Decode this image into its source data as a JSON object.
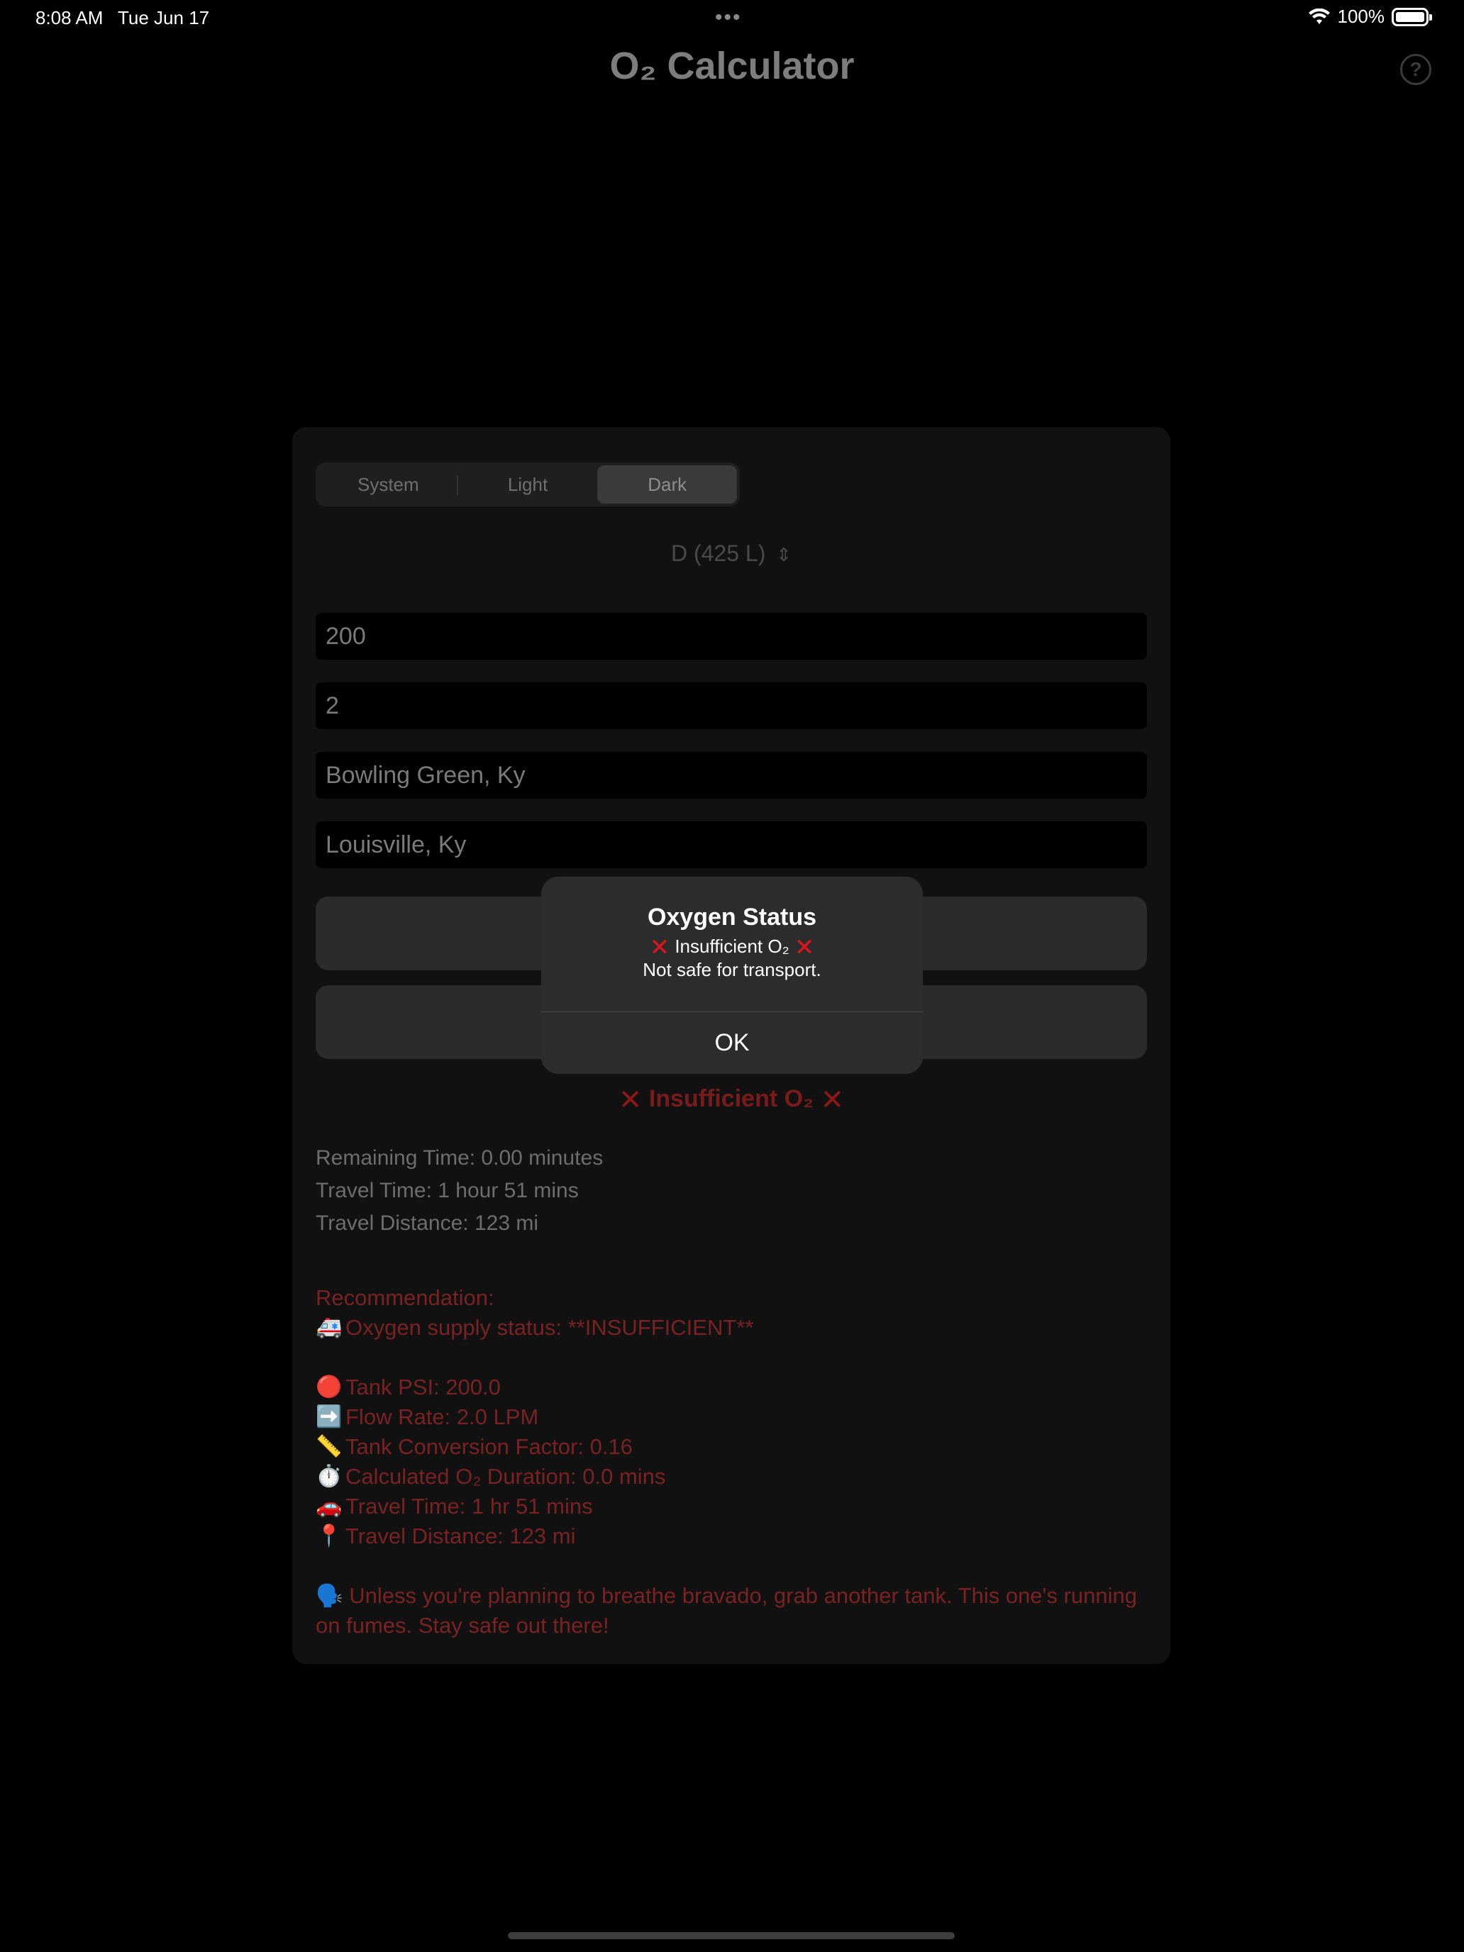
{
  "status_bar": {
    "time": "8:08 AM",
    "date": "Tue Jun 17",
    "dots": "•••",
    "battery": "100%"
  },
  "nav": {
    "title": "O₂ Calculator",
    "help_icon": "question-circle-icon",
    "help_glyph": "?"
  },
  "appearance": {
    "options": [
      "System",
      "Light",
      "Dark"
    ],
    "selected": "Dark"
  },
  "tank": {
    "value": "D (425 L)",
    "chevron_glyph": "⌃⌄"
  },
  "fields": {
    "psi": "200",
    "flow": "2",
    "origin": "Bowling Green, Ky",
    "destination": "Louisville, Ky"
  },
  "status": {
    "icon": "✕",
    "text": "Insufficient O₂"
  },
  "results": {
    "remaining": "Remaining Time: 0.00 minutes",
    "travel_time": "Travel Time: 1 hour 51 mins",
    "travel_distance": "Travel Distance: 123 mi"
  },
  "recommendation": {
    "heading": "Recommendation:",
    "supply": {
      "emoji": "🚑",
      "text": "Oxygen supply status: **INSUFFICIENT**"
    },
    "items": [
      {
        "emoji": "🔴",
        "text": "Tank PSI: 200.0"
      },
      {
        "emoji": "➡️",
        "text": "Flow Rate: 2.0 LPM"
      },
      {
        "emoji": "📏",
        "text": "Tank Conversion Factor: 0.16"
      },
      {
        "emoji": "⏱️",
        "text": "Calculated O₂ Duration: 0.0 mins"
      },
      {
        "emoji": "🚗",
        "text": "Travel Time: 1 hr 51 mins"
      },
      {
        "emoji": "📍",
        "text": "Travel Distance: 123 mi"
      }
    ],
    "advice": {
      "emoji": "🗣️",
      "text": "Unless you're planning to breathe bravado, grab another tank. This one's running on fumes. Stay safe out there!"
    }
  },
  "alert": {
    "title": "Oxygen Status",
    "icon": "✕",
    "line1": "Insufficient O₂",
    "line2": "Not safe for transport.",
    "ok_label": "OK"
  },
  "colors": {
    "background": "#000000",
    "card": "#111111",
    "danger": "#7a2222",
    "alert_x": "#e0141f"
  }
}
